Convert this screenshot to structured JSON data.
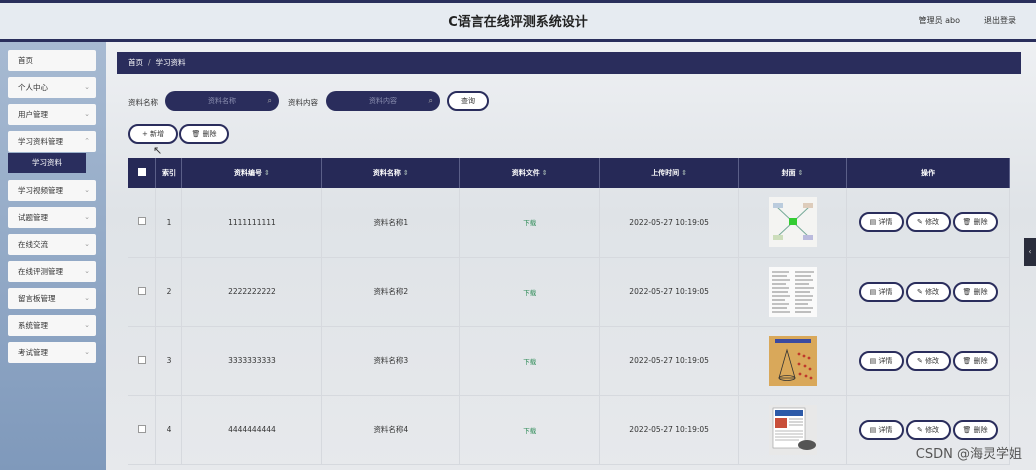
{
  "header": {
    "title": "C语言在线评测系统设计",
    "user": "管理员 abo",
    "logout": "退出登录"
  },
  "sidebar": {
    "items": [
      {
        "label": "首页",
        "chevron": false
      },
      {
        "label": "个人中心",
        "chevron": true
      },
      {
        "label": "用户管理",
        "chevron": true
      },
      {
        "label": "学习资料管理",
        "chevron": true
      },
      {
        "label": "学习视频管理",
        "chevron": true
      },
      {
        "label": "试题管理",
        "chevron": true
      },
      {
        "label": "在线交流",
        "chevron": true
      },
      {
        "label": "在线评测管理",
        "chevron": true
      },
      {
        "label": "留言板管理",
        "chevron": true
      },
      {
        "label": "系统管理",
        "chevron": true
      },
      {
        "label": "考试管理",
        "chevron": true
      }
    ],
    "submenu": {
      "label": "学习资料"
    }
  },
  "breadcrumb": {
    "home": "首页",
    "sep": "/",
    "current": "学习资料"
  },
  "search": {
    "name_label": "资料名称",
    "name_placeholder": "资料名称",
    "content_label": "资料内容",
    "content_placeholder": "资料内容",
    "query_button": "查询"
  },
  "actions": {
    "add": "+ 新增",
    "delete": "删除"
  },
  "table": {
    "columns": [
      "索引",
      "资料编号",
      "资料名称",
      "资料文件",
      "上传时间",
      "封面",
      "操作"
    ],
    "rows": [
      {
        "index": "1",
        "code": "1111111111",
        "name": "资料名称1",
        "file": "下载",
        "time": "2022-05-27 10:19:05"
      },
      {
        "index": "2",
        "code": "2222222222",
        "name": "资料名称2",
        "file": "下载",
        "time": "2022-05-27 10:19:05"
      },
      {
        "index": "3",
        "code": "3333333333",
        "name": "资料名称3",
        "file": "下载",
        "time": "2022-05-27 10:19:05"
      },
      {
        "index": "4",
        "code": "4444444444",
        "name": "资料名称4",
        "file": "下载",
        "time": "2022-05-27 10:19:05"
      }
    ],
    "row_actions": {
      "detail": "详情",
      "edit": "修改",
      "delete": "删除"
    }
  },
  "watermark": "CSDN @海灵学姐",
  "colors": {
    "primary": "#2a2d5c",
    "download": "#2e8b57"
  }
}
